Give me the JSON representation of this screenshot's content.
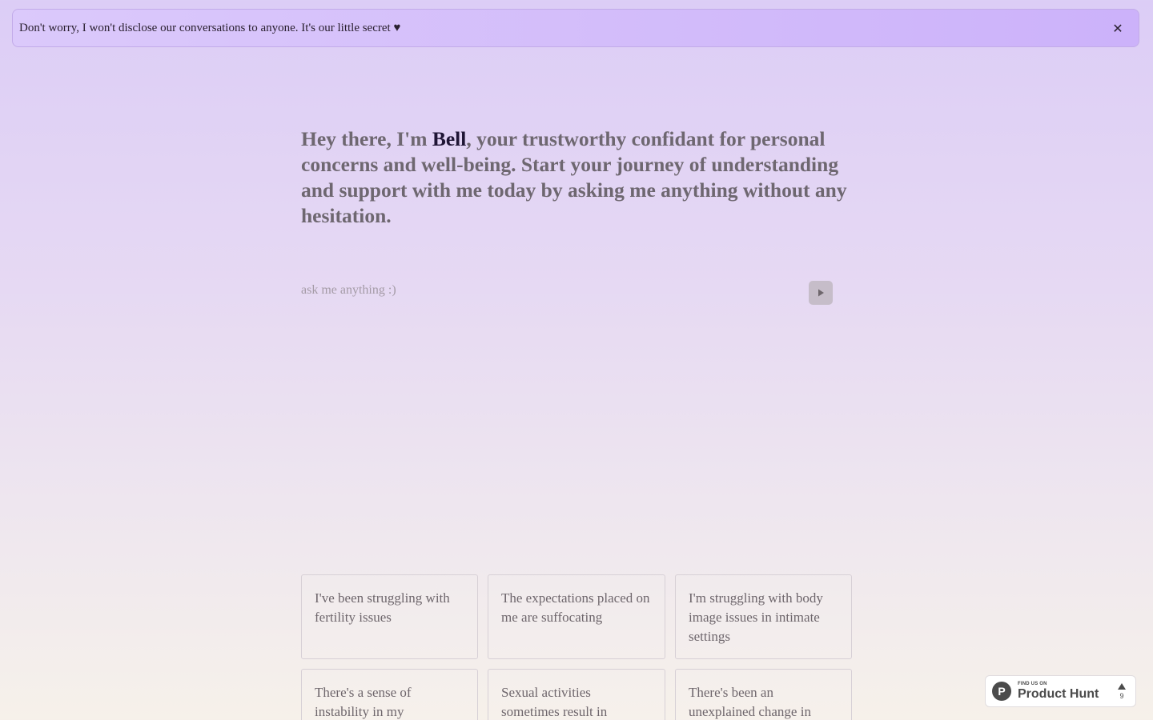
{
  "banner": {
    "message": "Don't worry, I won't disclose our conversations to anyone. It's our little secret ♥",
    "close_icon": "close-icon"
  },
  "intro": {
    "before_name": "Hey there, I'm ",
    "name": "Bell",
    "after_name": ", your trustworthy confidant for personal concerns and well-being. Start your journey of understanding and support with me today by asking me anything without any hesitation."
  },
  "ask": {
    "placeholder": "ask me anything :)",
    "value": "",
    "send_icon": "play-icon"
  },
  "suggestions": [
    "I've been struggling with fertility issues",
    "The expectations placed on me are suffocating",
    "I'm struggling with body image issues in intimate settings",
    "There's a sense of instability in my",
    "Sexual activities sometimes result in",
    "There's been an unexplained change in"
  ],
  "product_hunt": {
    "small_label": "FIND US ON",
    "big_label": "Product Hunt",
    "logo_letter": "P",
    "votes": "9"
  },
  "colors": {
    "banner_bg": "#ccb2fa",
    "name_color": "#1f1535",
    "headline_color": "#6e6770"
  }
}
